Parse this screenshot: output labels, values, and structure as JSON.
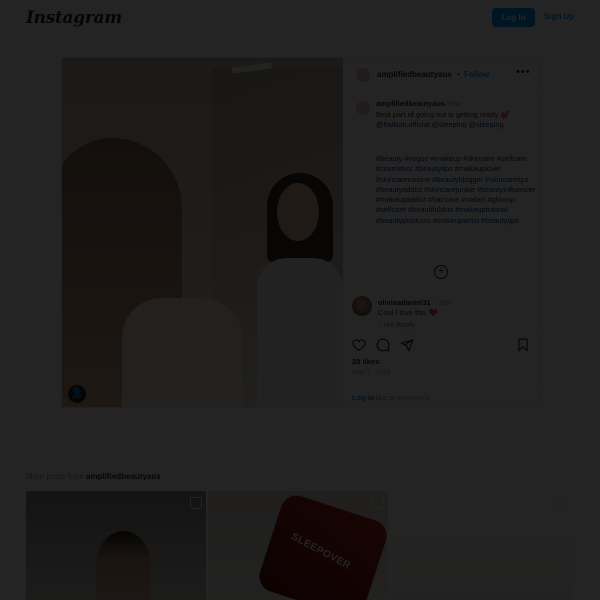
{
  "app": {
    "logo": "Instagram"
  },
  "topbar": {
    "login_label": "Log In",
    "signup_label": "Sign Up"
  },
  "post": {
    "username": "amplifiedbeautyaus",
    "follow_separator": "•",
    "follow_label": "Follow",
    "time": "30w",
    "caption": "Best part of going out is getting ready 💕",
    "caption_tags": "@hailsalt.official @sleeping @sleeping",
    "hashtags": "#beauty #vogue #makeup #skincare #selfcare #cosmetics #beautytips #makeuplover #skincareroutine #beautyblogger #skincaretips #beautyaddict #skincarejunkie #beautyinfluencer #makeupaddict #haircare #nailart #glowup #selfcare #beautifulskin #makeuptutorial #beautyproducts #makeupartist #beautytips",
    "comment": {
      "username": "oliviaadaniel31",
      "time": "30w",
      "text": "Cool I love this ❤️",
      "likes": "1 like",
      "reply": "Reply"
    },
    "likes": "28 likes",
    "date": "May 7, 2023",
    "login_link": "Log in",
    "login_text": "to like or comment."
  },
  "more_posts": {
    "prefix": "More posts from",
    "username": "amplifiedbeautyaus",
    "sleep_label": "SLEEPOVER"
  },
  "colors": {
    "accent": "#0095f6",
    "overlay": "rgba(0,0,0,0.86)"
  },
  "icons": [
    "more-icon",
    "add-circle-icon",
    "heart-icon",
    "comment-icon",
    "share-icon",
    "bookmark-icon",
    "user-tag-icon",
    "reel-icon"
  ]
}
